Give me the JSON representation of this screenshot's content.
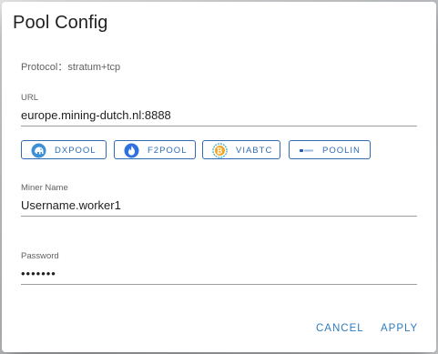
{
  "dialog": {
    "title": "Pool Config",
    "protocol_text": "Protocol：stratum+tcp"
  },
  "url": {
    "label": "URL",
    "value": "europe.mining-dutch.nl:8888"
  },
  "pools": [
    {
      "label": "DXPOOL",
      "icon": "dxpool-elephant-icon"
    },
    {
      "label": "F2POOL",
      "icon": "f2pool-flame-icon"
    },
    {
      "label": "VIABTC",
      "icon": "viabtc-bitcoin-icon"
    },
    {
      "label": "POOLIN",
      "icon": "poolin-logo-icon"
    }
  ],
  "miner": {
    "label": "Miner Name",
    "value": "Username.worker1"
  },
  "password": {
    "label": "Password",
    "value": "•••••••"
  },
  "actions": {
    "cancel": "CANCEL",
    "apply": "APPLY"
  },
  "colors": {
    "accent": "#2e6db5",
    "action_text": "#2e7cc0",
    "title_text": "#212121"
  }
}
